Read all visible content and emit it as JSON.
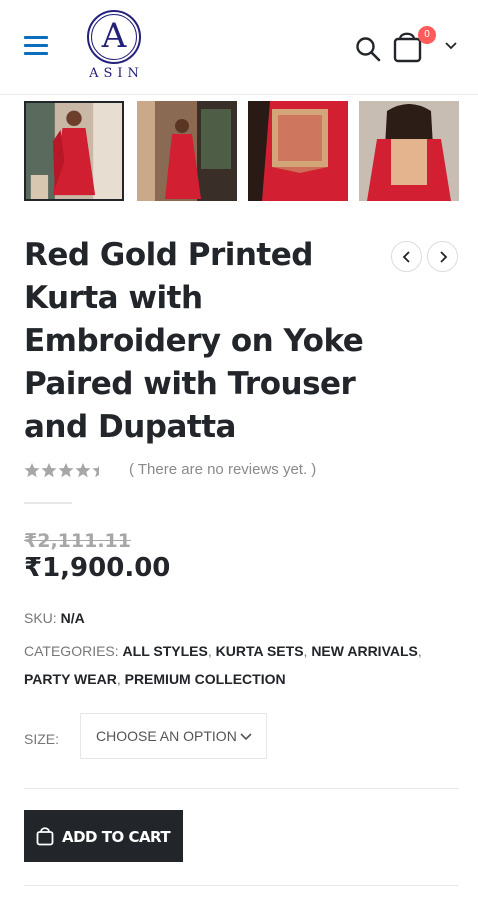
{
  "header": {
    "logo_letter": "A",
    "logo_text": "ASIN",
    "cart_count": "0"
  },
  "product": {
    "title": "Red Gold Printed Kurta with Embroidery on Yoke Paired with Trouser and Dupatta",
    "rating": 4.5,
    "rating_max": 5,
    "reviews_text": "( There are no reviews yet. )",
    "old_price": "₹2,111.11",
    "price": "₹1,900.00"
  },
  "meta": {
    "sku_label": "SKU:",
    "sku_value": "N/A",
    "categories_label": "CATEGORIES:",
    "categories": [
      "All Styles",
      "Kurta Sets",
      "New Arrivals",
      "Party Wear",
      "Premium Collection"
    ]
  },
  "variation": {
    "size_label": "SIZE:",
    "size_placeholder": "CHOOSE AN OPTION"
  },
  "actions": {
    "add_to_cart": "ADD TO CART"
  },
  "colors": {
    "accent_blue": "#0a6ebd",
    "logo_navy": "#24217a",
    "badge_red": "#ff5b5b",
    "dark": "#222529",
    "dress_red": "#d21f32"
  },
  "icons": [
    "hamburger-menu-icon",
    "search-icon",
    "shopping-bag-icon",
    "chevron-down-icon",
    "chevron-left-icon",
    "chevron-right-icon",
    "star-icon"
  ]
}
